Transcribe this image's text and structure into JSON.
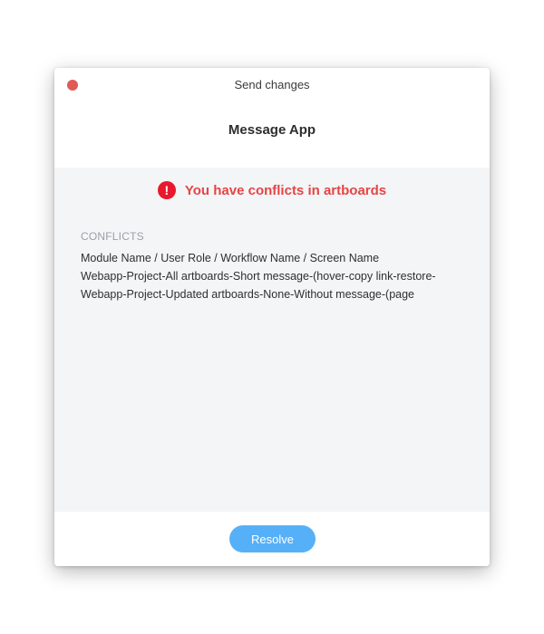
{
  "window": {
    "title": "Send changes"
  },
  "header": {
    "app_name": "Message App"
  },
  "alert": {
    "icon": "exclamation-icon",
    "icon_glyph": "!",
    "message": "You have conflicts in artboards",
    "color": "#e54545"
  },
  "conflicts": {
    "label": "CONFLICTS",
    "column_header": "Module Name / User Role / Workflow Name / Screen Name",
    "items": [
      "Webapp-Project-All artboards-Short message-(hover-copy link-restore-",
      "Webapp-Project-Updated artboards-None-Without message-(page"
    ]
  },
  "footer": {
    "resolve_label": "Resolve",
    "accent": "#56b0f8"
  }
}
